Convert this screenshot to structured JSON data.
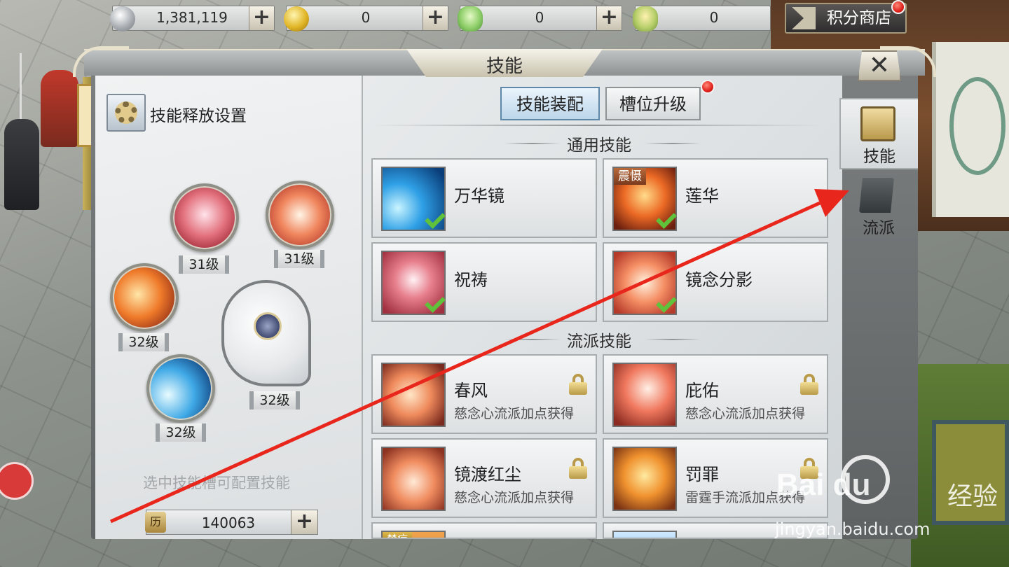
{
  "currencies": [
    {
      "name": "silver-coin",
      "value": "1,381,119"
    },
    {
      "name": "gold-coin",
      "value": "0"
    },
    {
      "name": "jade-ingot",
      "value": "0"
    },
    {
      "name": "bound-jade-ingot",
      "value": "0"
    }
  ],
  "shop": {
    "label": "积分商店"
  },
  "panel": {
    "title": "技能"
  },
  "left": {
    "settings_label": "技能释放设置",
    "slot_levels": [
      "31级",
      "31级",
      "32级",
      "32级",
      "32级"
    ],
    "hint": "选中技能槽可配置技能",
    "points": "140063",
    "points_icon": "历"
  },
  "tabs": {
    "equip": "技能装配",
    "upgrade": "槽位升级"
  },
  "sections": {
    "common": "通用技能",
    "school": "流派技能"
  },
  "common_skills": [
    {
      "name": "万华镜",
      "equipped": true
    },
    {
      "name": "莲华",
      "equipped": true,
      "badge": "震慑"
    },
    {
      "name": "祝祷",
      "equipped": true
    },
    {
      "name": "镜念分影",
      "equipped": true
    }
  ],
  "school_skills": [
    {
      "name": "春风",
      "desc": "慈念心流派加点获得",
      "locked": true
    },
    {
      "name": "庇佑",
      "desc": "慈念心流派加点获得",
      "locked": true
    },
    {
      "name": "镜渡红尘",
      "desc": "慈念心流派加点获得",
      "locked": true
    },
    {
      "name": "罚罪",
      "desc": "雷霆手流派加点获得",
      "locked": true
    }
  ],
  "partial_badge": "禁疗",
  "side_tabs": [
    "技能",
    "流派"
  ],
  "watermark": {
    "logo": "Bai du",
    "cn": "经验",
    "url": "jingyan.baidu.com"
  },
  "colors": {
    "annotation_arrow": "#e8261c",
    "equipped_check": "#5fc23a"
  }
}
